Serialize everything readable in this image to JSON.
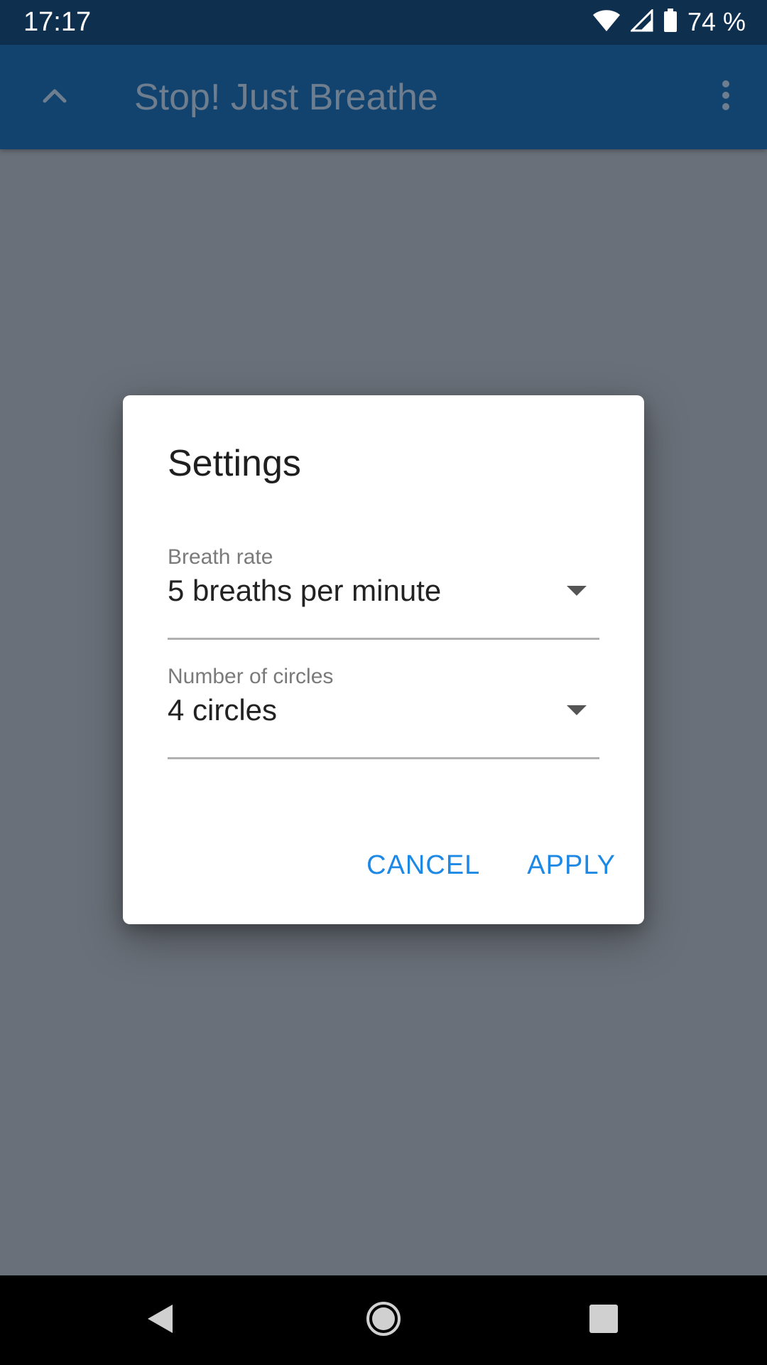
{
  "status_bar": {
    "time": "17:17",
    "battery_text": "74 %",
    "icons": [
      "wifi-icon",
      "signal-icon",
      "battery-icon"
    ]
  },
  "app_bar": {
    "title": "Stop! Just Breathe",
    "up_icon": "chevron-up-icon",
    "menu_icon": "more-vert-icon"
  },
  "dialog": {
    "title": "Settings",
    "fields": [
      {
        "label": "Breath rate",
        "value": "5 breaths per minute"
      },
      {
        "label": "Number of circles",
        "value": "4 circles"
      }
    ],
    "cancel_label": "CANCEL",
    "apply_label": "APPLY"
  },
  "nav_bar": {
    "icons": [
      "back-icon",
      "home-icon",
      "recents-icon"
    ]
  },
  "colors": {
    "status_bar": "#0f2f4f",
    "app_bar": "#12436f",
    "scrim_background": "#6a7079",
    "accent": "#1e88e5"
  }
}
